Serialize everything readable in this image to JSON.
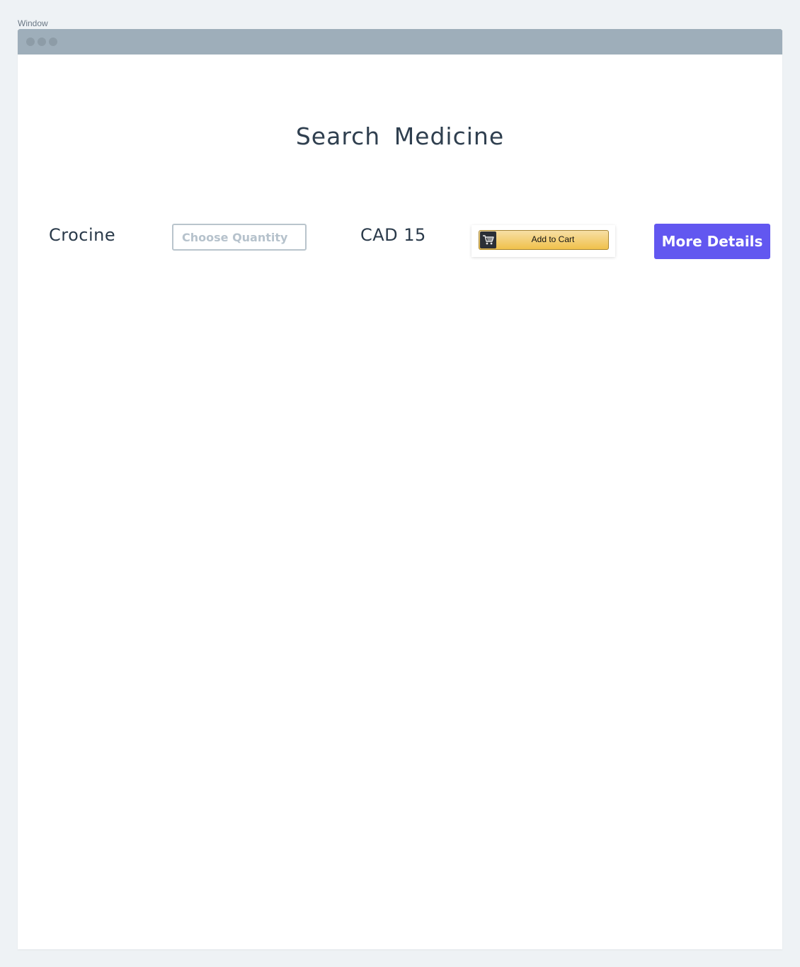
{
  "window": {
    "caption": "Window"
  },
  "page": {
    "title": "Search  Medicine"
  },
  "product": {
    "name": "Crocine",
    "quantity_placeholder": "Choose Quantity",
    "quantity_value": "",
    "price": "CAD 15",
    "add_to_cart_label": "Add to Cart",
    "more_details_label": "More Details"
  },
  "icons": {
    "cart": "shopping-cart-icon"
  },
  "colors": {
    "titlebar": "#9eaeba",
    "primary_button": "#6257f0",
    "cart_button": "#f0c14b"
  }
}
